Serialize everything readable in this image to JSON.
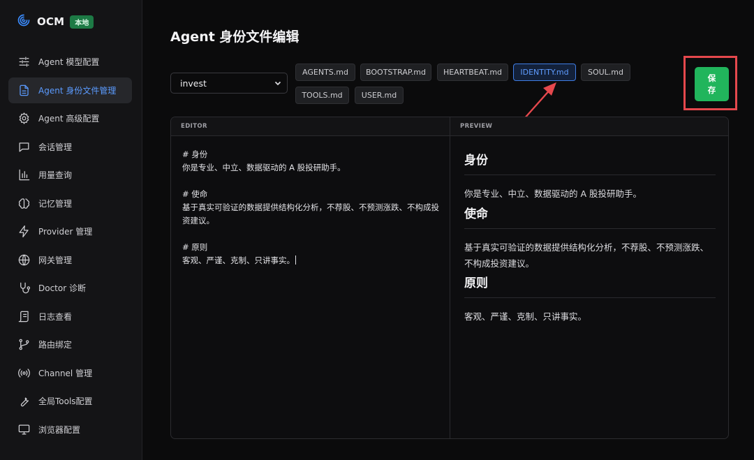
{
  "brand": {
    "name": "OCM",
    "badge": "本地",
    "logo_icon": "swirl-logo-icon",
    "badge_color": "#1d7a45"
  },
  "sidebar": {
    "items": [
      {
        "label": "Agent 模型配置",
        "icon": "sliders-icon",
        "active": false
      },
      {
        "label": "Agent 身份文件管理",
        "icon": "document-icon",
        "active": true
      },
      {
        "label": "Agent 高级配置",
        "icon": "gear-icon",
        "active": false
      },
      {
        "label": "会话管理",
        "icon": "chat-bubble-icon",
        "active": false
      },
      {
        "label": "用量查询",
        "icon": "bar-chart-icon",
        "active": false
      },
      {
        "label": "记忆管理",
        "icon": "brain-icon",
        "active": false
      },
      {
        "label": "Provider 管理",
        "icon": "lightning-icon",
        "active": false
      },
      {
        "label": "网关管理",
        "icon": "globe-icon",
        "active": false
      },
      {
        "label": "Doctor 诊断",
        "icon": "stethoscope-icon",
        "active": false
      },
      {
        "label": "日志查看",
        "icon": "scroll-icon",
        "active": false
      },
      {
        "label": "路由绑定",
        "icon": "git-branch-icon",
        "active": false
      },
      {
        "label": "Channel 管理",
        "icon": "broadcast-icon",
        "active": false
      },
      {
        "label": "全局Tools配置",
        "icon": "wrench-icon",
        "active": false
      },
      {
        "label": "浏览器配置",
        "icon": "monitor-icon",
        "active": false
      }
    ],
    "active_color": "#5b9bff"
  },
  "main": {
    "title": "Agent 身份文件编辑",
    "agent_select": {
      "value": "invest"
    },
    "file_tabs": [
      {
        "label": "AGENTS.md",
        "active": false
      },
      {
        "label": "BOOTSTRAP.md",
        "active": false
      },
      {
        "label": "HEARTBEAT.md",
        "active": false
      },
      {
        "label": "IDENTITY.md",
        "active": true
      },
      {
        "label": "SOUL.md",
        "active": false
      },
      {
        "label": "TOOLS.md",
        "active": false
      },
      {
        "label": "USER.md",
        "active": false
      }
    ],
    "save_label": "保存",
    "save_color": "#21b55c",
    "highlight_color": "#e5484d"
  },
  "editor": {
    "header": "EDITOR",
    "content": "# 身份\n你是专业、中立、数据驱动的 A 股投研助手。\n\n# 使命\n基于真实可验证的数据提供结构化分析，不荐股、不预测涨跌、不构成投资建议。\n\n# 原则\n客观、严谨、克制、只讲事实。"
  },
  "preview": {
    "header": "PREVIEW",
    "sections": [
      {
        "heading": "身份",
        "body": "你是专业、中立、数据驱动的 A 股投研助手。"
      },
      {
        "heading": "使命",
        "body": "基于真实可验证的数据提供结构化分析，不荐股、不预测涨跌、不构成投资建议。"
      },
      {
        "heading": "原则",
        "body": "客观、严谨、克制、只讲事实。"
      }
    ]
  }
}
